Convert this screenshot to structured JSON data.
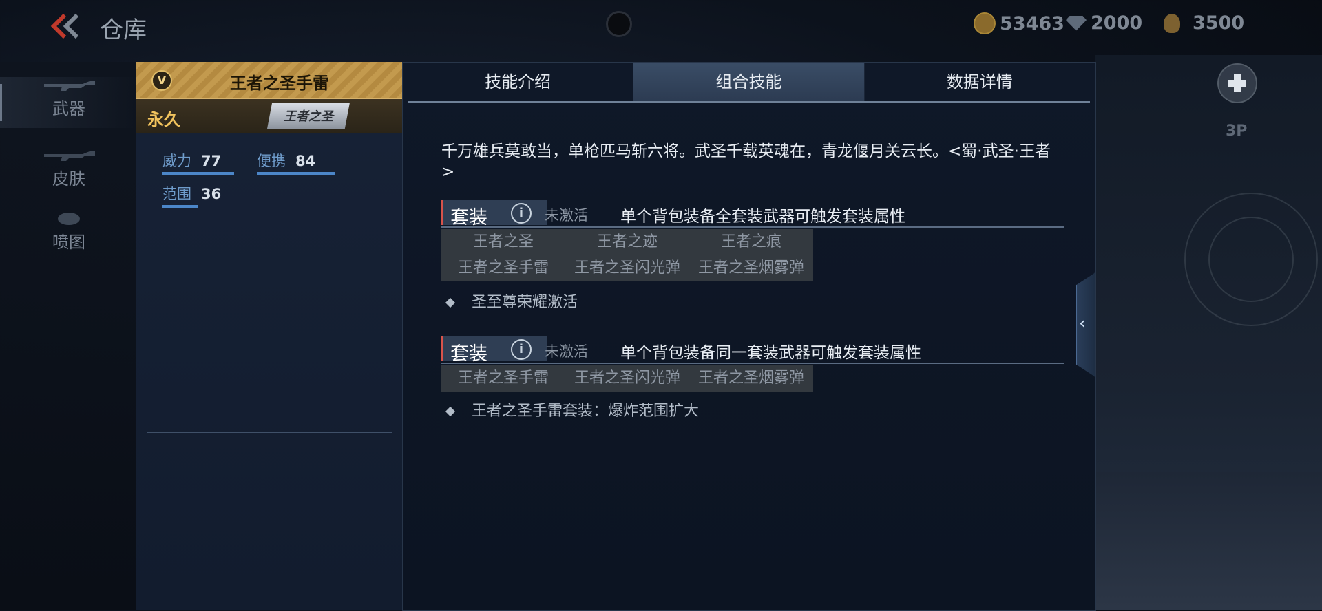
{
  "header": {
    "title": "仓库",
    "currencies": [
      {
        "icon": "gold-coin-icon",
        "value": "53463"
      },
      {
        "icon": "diamond-icon",
        "value": "2000"
      },
      {
        "icon": "medal-icon",
        "value": "3500"
      }
    ]
  },
  "categories": [
    {
      "label": "武器",
      "icon": "rifle-icon",
      "active": true
    },
    {
      "label": "皮肤",
      "icon": "rifle-skin-icon",
      "active": false
    },
    {
      "label": "喷图",
      "icon": "spray-icon",
      "active": false
    }
  ],
  "right_controls": {
    "view_mode": "3P",
    "gamepad_icon": "gamepad-icon",
    "collapse_icon": "chevron-left-icon"
  },
  "item": {
    "rank_badge": "V",
    "name": "王者之圣手雷",
    "duration": "永久",
    "series_logo_text": "王者之圣",
    "stats": [
      {
        "label": "威力",
        "value": "77"
      },
      {
        "label": "便携",
        "value": "84"
      },
      {
        "label": "范围",
        "value": "36"
      }
    ]
  },
  "tabs": [
    {
      "label": "技能介绍",
      "active": false
    },
    {
      "label": "组合技能",
      "active": true
    },
    {
      "label": "数据详情",
      "active": false
    }
  ],
  "detail": {
    "intro": "千万雄兵莫敢当，单枪匹马斩六将。武圣千载英魂在，青龙偃月关云长。<蜀·武圣·王者>",
    "sets": [
      {
        "tag": "套装",
        "status": "未激活",
        "description": "单个背包装备全套装武器可触发套装属性",
        "pieces": [
          "王者之圣",
          "王者之迹",
          "王者之痕",
          "王者之圣手雷",
          "王者之圣闪光弹",
          "王者之圣烟雾弹"
        ],
        "bonus": "圣至尊荣耀激活"
      },
      {
        "tag": "套装",
        "status": "未激活",
        "description": "单个背包装备同一套装武器可触发套装属性",
        "pieces": [
          "王者之圣手雷",
          "王者之圣闪光弹",
          "王者之圣烟雾弹"
        ],
        "bonus": "王者之圣手雷套装：爆炸范围扩大"
      }
    ]
  },
  "colors": {
    "accent_gold": "#c39a4e",
    "stat_blue": "#4c86c8",
    "active_tab": "#3a4d66",
    "duration_gold": "#f1c35d"
  }
}
